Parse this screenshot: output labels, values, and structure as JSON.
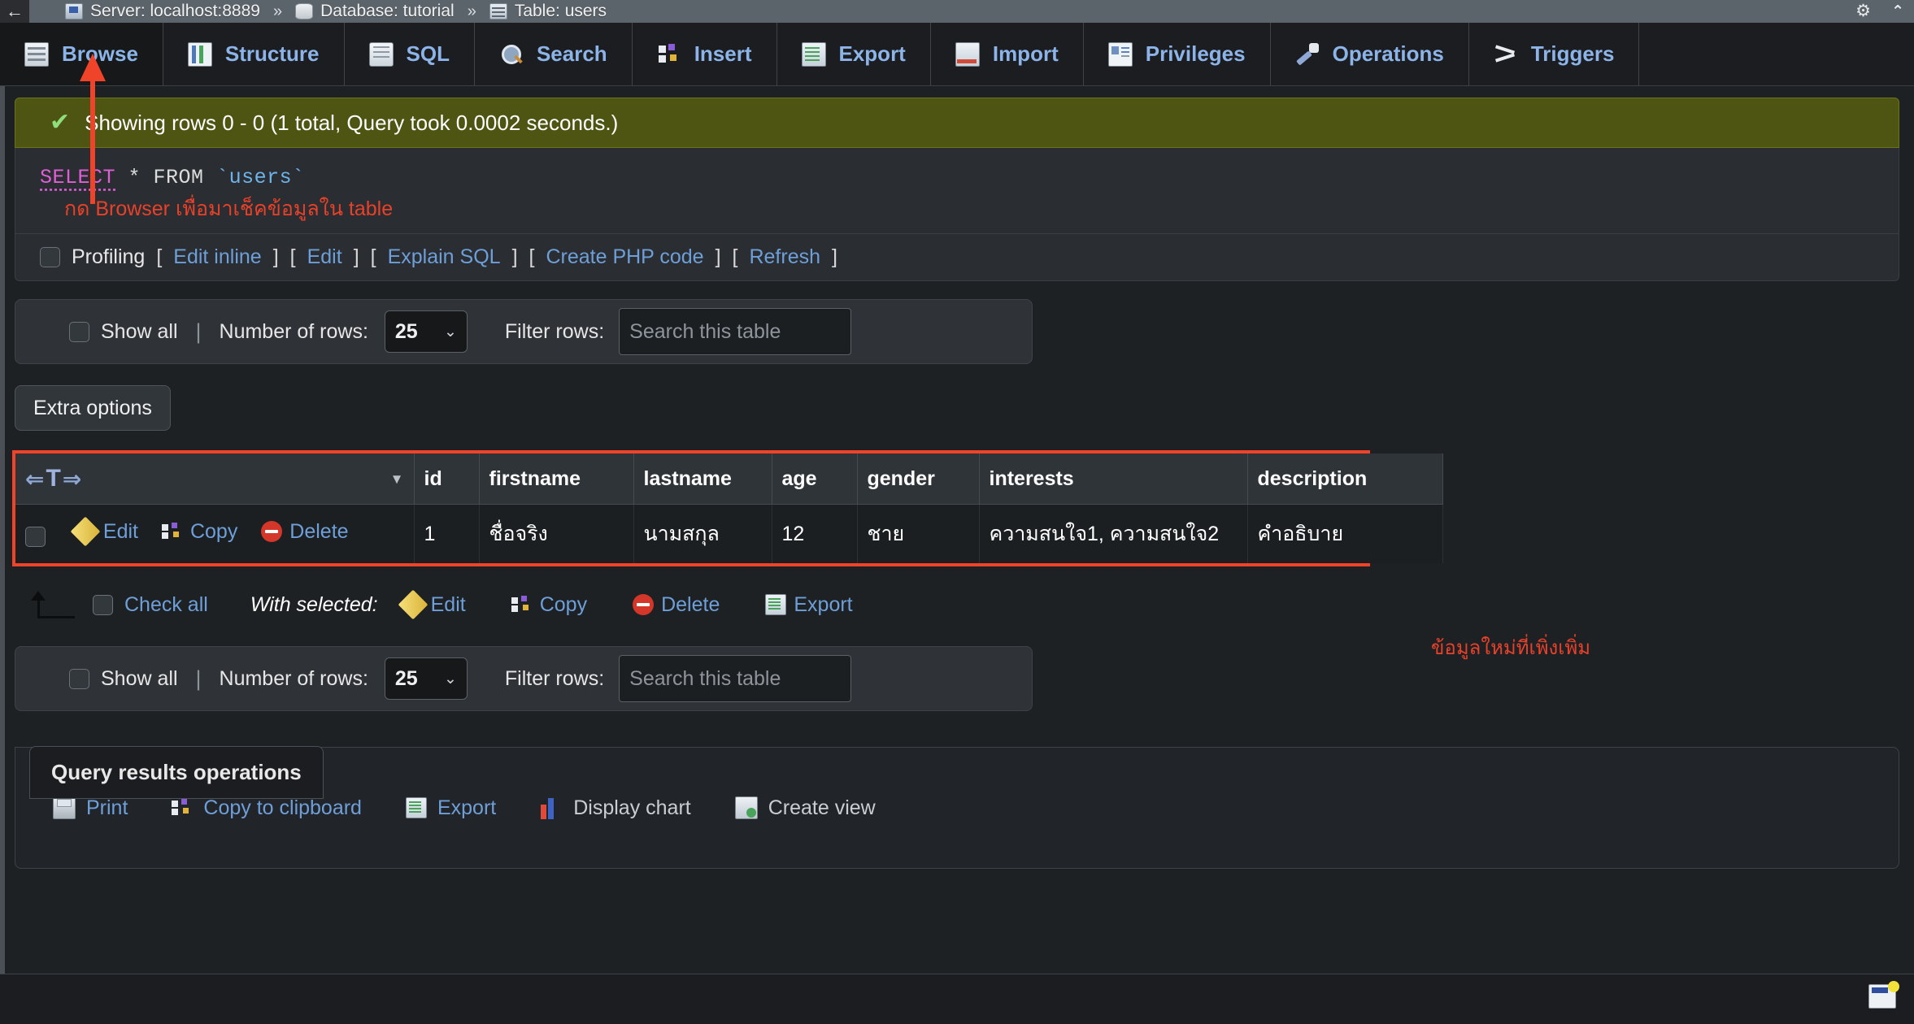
{
  "breadcrumb": {
    "back_label": "←",
    "items": [
      {
        "icon": "server-icon",
        "label": "Server: localhost:8889"
      },
      {
        "icon": "database-icon",
        "label": "Database: tutorial"
      },
      {
        "icon": "table-icon",
        "label": "Table: users"
      }
    ],
    "separator": "»",
    "gear_icon": "⚙",
    "collapse_icon": "⌃"
  },
  "tabs": [
    {
      "label": "Browse",
      "icon": "browse-icon",
      "active": true
    },
    {
      "label": "Structure",
      "icon": "structure-icon",
      "active": false
    },
    {
      "label": "SQL",
      "icon": "sql-icon",
      "active": false
    },
    {
      "label": "Search",
      "icon": "search-icon",
      "active": false
    },
    {
      "label": "Insert",
      "icon": "insert-icon",
      "active": false
    },
    {
      "label": "Export",
      "icon": "export-icon",
      "active": false
    },
    {
      "label": "Import",
      "icon": "import-icon",
      "active": false
    },
    {
      "label": "Privileges",
      "icon": "privileges-icon",
      "active": false
    },
    {
      "label": "Operations",
      "icon": "operations-icon",
      "active": false
    },
    {
      "label": "Triggers",
      "icon": "triggers-icon",
      "active": false
    }
  ],
  "result_status": {
    "check_icon": "✔",
    "message": "Showing rows 0 - 0 (1 total, Query took 0.0002 seconds.)"
  },
  "sql": {
    "keyword": "SELECT",
    "operator": "* FROM",
    "table": "`users`",
    "annotation": "กด Browser เพื่อมาเช็คข้อมูลใน table"
  },
  "profiling": {
    "label": "Profiling",
    "links": [
      "Edit inline",
      "Edit",
      "Explain SQL",
      "Create PHP code",
      "Refresh"
    ],
    "bracket_open": "[",
    "bracket_close": "]"
  },
  "filter_toolbar": {
    "show_all_label": "Show all",
    "divider": "|",
    "rows_label": "Number of rows:",
    "rows_value": "25",
    "chevron": "⌄",
    "filter_label": "Filter rows:",
    "filter_placeholder": "Search this table",
    "filter_value": ""
  },
  "extra_options": {
    "label": "Extra options"
  },
  "table": {
    "sort_header_icons": "⇐T⇒",
    "header_caret": "▼",
    "columns": [
      "id",
      "firstname",
      "lastname",
      "age",
      "gender",
      "interests",
      "description"
    ],
    "row_actions": [
      {
        "label": "Edit",
        "icon": "pencil-icon"
      },
      {
        "label": "Copy",
        "icon": "copy-icon"
      },
      {
        "label": "Delete",
        "icon": "delete-icon"
      }
    ],
    "rows": [
      {
        "id": "1",
        "firstname": "ชื่อจริง",
        "lastname": "นามสกุล",
        "age": "12",
        "gender": "ชาย",
        "interests": "ความสนใจ1, ความสนใจ2",
        "description": "คำอธิบาย"
      }
    ],
    "side_annotation": "ข้อมูลใหม่ที่เพิ่งเพิ่ม",
    "highlight_color": "#f0442a"
  },
  "with_selected": {
    "check_all_label": "Check all",
    "prefix": "With selected:",
    "actions": [
      {
        "label": "Edit",
        "icon": "pencil-icon"
      },
      {
        "label": "Copy",
        "icon": "copy-icon"
      },
      {
        "label": "Delete",
        "icon": "delete-icon"
      },
      {
        "label": "Export",
        "icon": "export-icon"
      }
    ]
  },
  "query_results_operations": {
    "title": "Query results operations",
    "items": [
      {
        "label": "Print",
        "icon": "printer-icon"
      },
      {
        "label": "Copy to clipboard",
        "icon": "clipboard-icon"
      },
      {
        "label": "Export",
        "icon": "export-icon"
      },
      {
        "label": "Display chart",
        "icon": "chart-icon"
      },
      {
        "label": "Create view",
        "icon": "create-view-icon"
      }
    ]
  },
  "bottom": {
    "console_icon": "console-icon"
  }
}
